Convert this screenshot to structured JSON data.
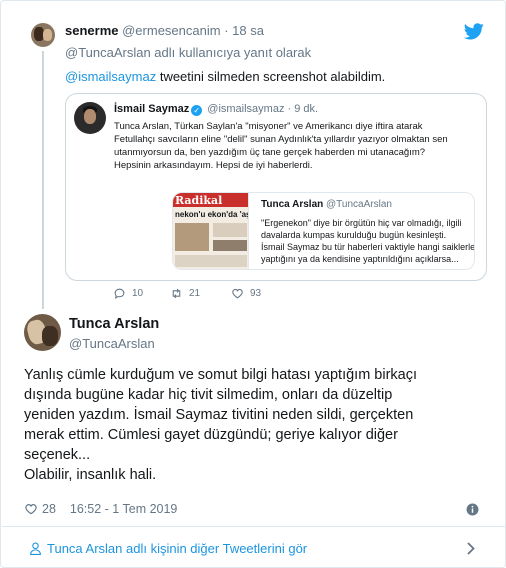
{
  "parent": {
    "name": "senerme",
    "handle": "@ermesencanim",
    "time": "· 18 sa",
    "reply_to": "@TuncaArslan adlı kullanıcıya yanıt olarak",
    "mention": "@ismailsaymaz",
    "text_rest": " tweetini silmeden screenshot alabildim.",
    "actions": {
      "replies": "10",
      "retweets": "21",
      "likes": "93"
    }
  },
  "quote": {
    "name": "İsmail Saymaz",
    "handle": "@ismailsaymaz · 9 dk.",
    "lines": [
      "Tunca Arslan, Türkan Saylan'a \"misyoner\" ve Amerikancı diye iftira atarak",
      "Fetullahçı savcıların eline \"delil\" sunan Aydınlık'ta yıllardır yazıyor olmaktan sen",
      "utanmıyorsun da, ben yazdığım üç tane gerçek haberden mi utanacağım?",
      "Hepsinin arkasındayım. Hepsi de iyi haberlerdi."
    ],
    "card": {
      "name": "Tunca Arslan",
      "handle": "@TuncaArslan",
      "image_text_top": "Radikal",
      "image_text_sub": "nekon'u  ekon'da 'aşk",
      "lines": [
        "\"Ergenekon\" diye bir örgütün hiç var olmadığı, ilgili",
        "davalarda kumpas kurulduğu bugün kesinleşti.",
        "İsmail Saymaz bu tür haberleri vaktiyle hangi saiklerle",
        "yaptığını ya da kendisine yaptırıldığını açıklarsa..."
      ]
    }
  },
  "main": {
    "name": "Tunca Arslan",
    "handle": "@TuncaArslan",
    "lines": [
      "Yanlış cümle kurduğum ve somut bilgi hatası yaptığım birkaçı",
      "dışında bugüne kadar hiç tivit silmedim, onları da düzeltip",
      "yeniden yazdım. İsmail Saymaz tivitini neden sildi, gerçekten",
      "merak ettim. Cümlesi gayet düzgündü; geriye kalıyor diğer",
      "seçenek...",
      "Olabilir, insanlık hali."
    ],
    "likes": "28",
    "timestamp": "16:52 - 1 Tem 2019"
  },
  "footer": {
    "more_tweets": "Tunca Arslan adlı kişinin diğer Tweetlerini gör"
  },
  "colors": {
    "link": "#1b95e0",
    "secondary_text": "#657786",
    "border": "#e1e8ed",
    "brand": "#1da1f2"
  },
  "icons": [
    "twitter-logo-icon",
    "reply-icon",
    "retweet-icon",
    "heart-icon",
    "info-icon",
    "person-icon",
    "chevron-right-icon",
    "verified-badge-icon"
  ]
}
